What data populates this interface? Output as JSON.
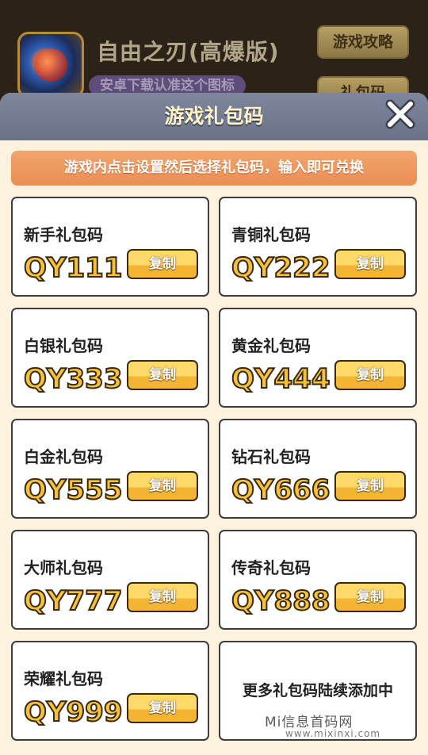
{
  "game": {
    "title": "自由之刃(高爆版)",
    "hint": "安卓下载认准这个图标",
    "guide_button": "游戏攻略",
    "gift_button": "礼包码"
  },
  "modal": {
    "title": "游戏礼包码",
    "close_icon": "close-icon",
    "instruction": "游戏内点击设置然后选择礼包码，输入即可兑换",
    "copy_label": "复制",
    "codes": [
      {
        "name": "新手礼包码",
        "code": "QY111"
      },
      {
        "name": "青铜礼包码",
        "code": "QY222"
      },
      {
        "name": "白银礼包码",
        "code": "QY333"
      },
      {
        "name": "黄金礼包码",
        "code": "QY444"
      },
      {
        "name": "白金礼包码",
        "code": "QY555"
      },
      {
        "name": "钻石礼包码",
        "code": "QY666"
      },
      {
        "name": "大师礼包码",
        "code": "QY777"
      },
      {
        "name": "传奇礼包码",
        "code": "QY888"
      },
      {
        "name": "荣耀礼包码",
        "code": "QY999"
      }
    ],
    "more_text": "更多礼包码陆续添加中"
  },
  "watermark": {
    "text": "Mi信息首码网",
    "url": "www.mixinxi.com"
  },
  "colors": {
    "modal_header": "#6f788f",
    "instruction_bg": "#ee9a5f",
    "code_fill": "#f7c23a",
    "copy_button": "#f7c23a"
  }
}
